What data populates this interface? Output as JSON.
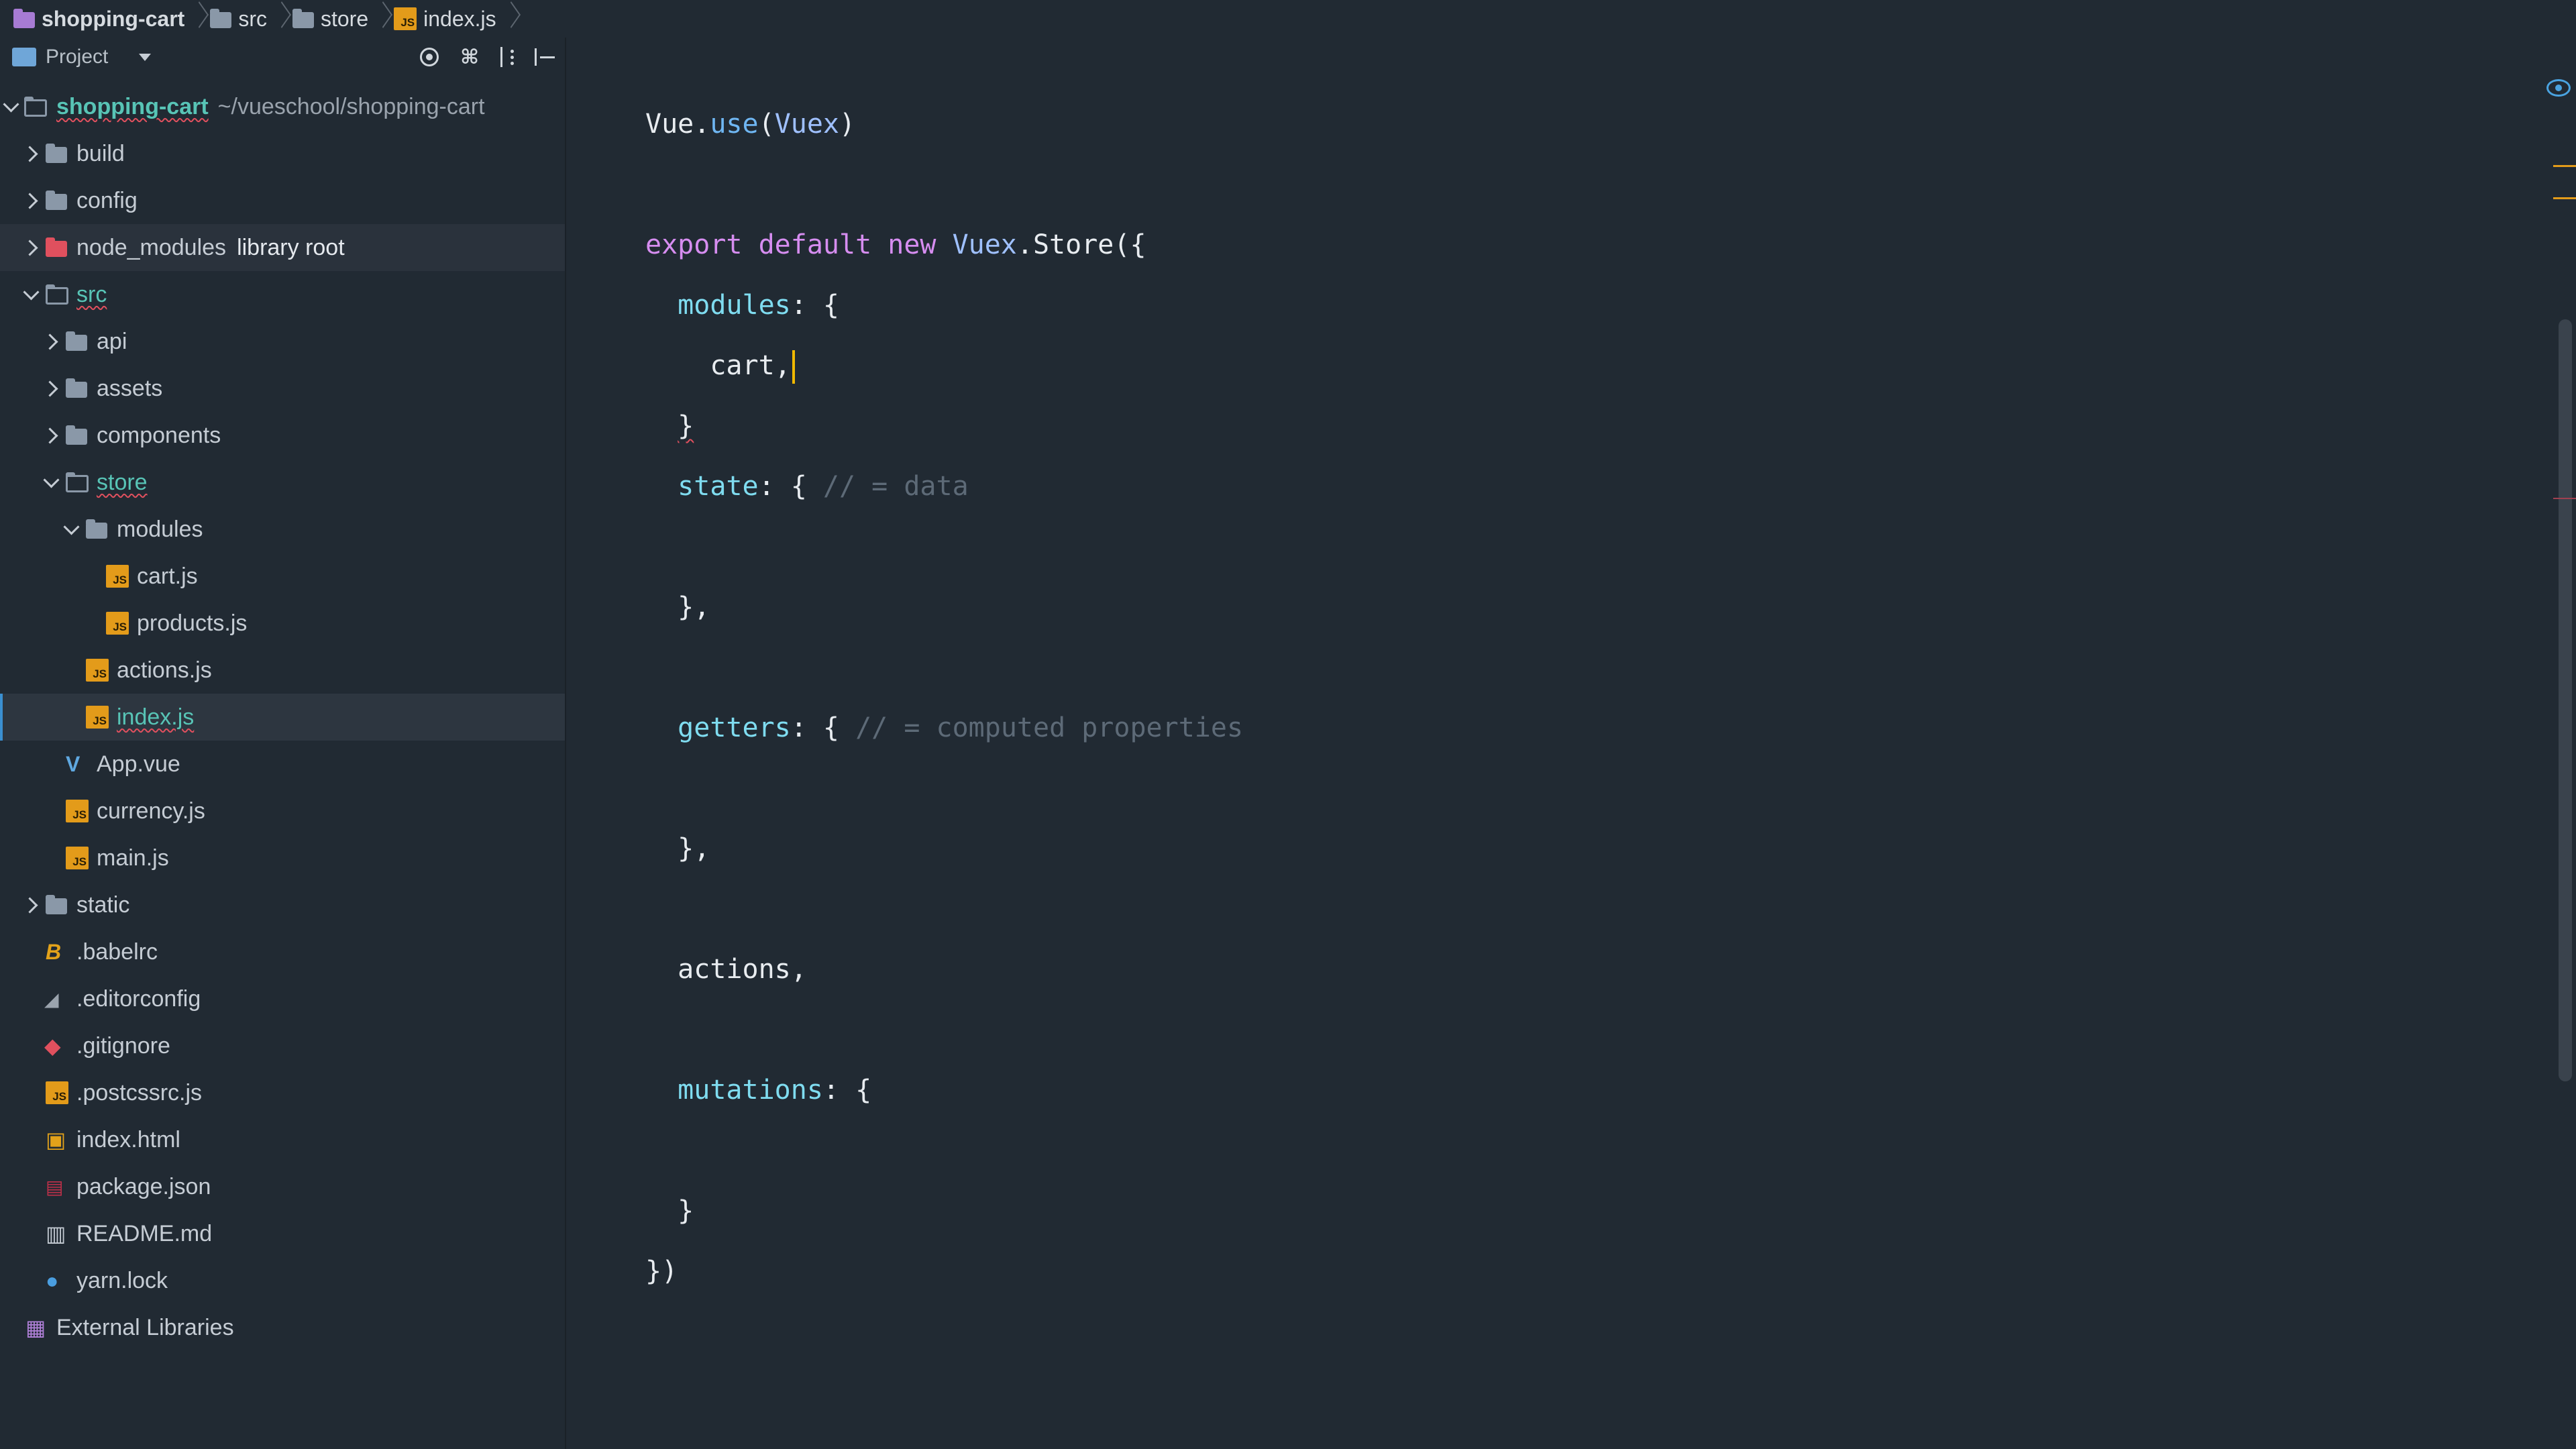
{
  "breadcrumb": [
    {
      "label": "shopping-cart",
      "icon": "project-folder-icon"
    },
    {
      "label": "src",
      "icon": "folder-icon"
    },
    {
      "label": "store",
      "icon": "folder-icon"
    },
    {
      "label": "index.js",
      "icon": "js-file-icon"
    }
  ],
  "panel": {
    "title": "Project"
  },
  "tree": [
    {
      "label": "shopping-cart",
      "path": "~/vueschool/shopping-cart"
    },
    {
      "label": "build"
    },
    {
      "label": "config"
    },
    {
      "label": "node_modules",
      "extra": "library root"
    },
    {
      "label": "src"
    },
    {
      "label": "api"
    },
    {
      "label": "assets"
    },
    {
      "label": "components"
    },
    {
      "label": "store"
    },
    {
      "label": "modules"
    },
    {
      "label": "cart.js"
    },
    {
      "label": "products.js"
    },
    {
      "label": "actions.js"
    },
    {
      "label": "index.js"
    },
    {
      "label": "App.vue"
    },
    {
      "label": "currency.js"
    },
    {
      "label": "main.js"
    },
    {
      "label": "static"
    },
    {
      "label": ".babelrc"
    },
    {
      "label": ".editorconfig"
    },
    {
      "label": ".gitignore"
    },
    {
      "label": ".postcssrc.js"
    },
    {
      "label": "index.html"
    },
    {
      "label": "package.json"
    },
    {
      "label": "README.md"
    },
    {
      "label": "yarn.lock"
    },
    {
      "label": "External Libraries"
    }
  ],
  "code": {
    "l1": {
      "a": "Vue",
      "b": ".",
      "c": "use",
      "d": "(",
      "e": "Vuex",
      "f": ")"
    },
    "l2": {
      "kw": "export default new ",
      "cls": "Vuex",
      "rest": ".Store({"
    },
    "l3": {
      "prop": "modules",
      "rest": ": {"
    },
    "l4": {
      "text": "cart,"
    },
    "l5": {
      "text": "}"
    },
    "l6": {
      "prop": "state",
      "rest": ": { ",
      "cmt": "// = data"
    },
    "l7": {
      "text": "},"
    },
    "l8": {
      "prop": "getters",
      "rest": ": { ",
      "cmt": "// = computed properties"
    },
    "l9": {
      "text": "},"
    },
    "l10": {
      "text": "actions,"
    },
    "l11": {
      "prop": "mutations",
      "rest": ": {"
    },
    "l12": {
      "text": "}"
    },
    "l13": {
      "text": "})"
    }
  }
}
